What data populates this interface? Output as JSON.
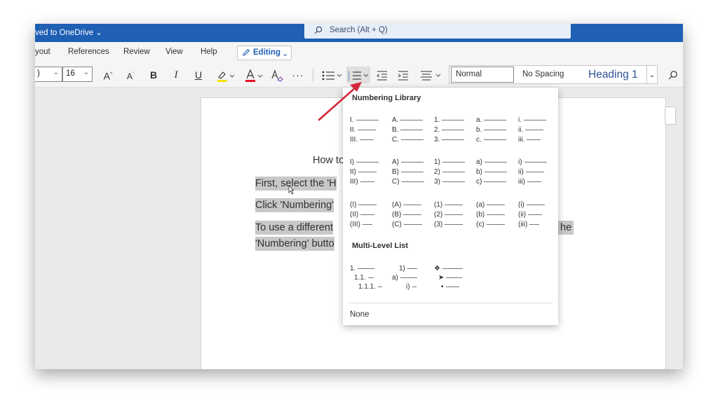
{
  "titlebar": {
    "saved_label": "ved to OneDrive ⌄",
    "search_placeholder": "Search (Alt + Q)"
  },
  "menu": {
    "items": [
      "yout",
      "References",
      "Review",
      "View",
      "Help"
    ],
    "editing": {
      "label": "Editing",
      "chevron": "⌄"
    }
  },
  "ribbon": {
    "font_name": ")",
    "font_size": "16",
    "buttons": {
      "grow": "A",
      "shrink": "A",
      "bold": "B",
      "italic": "I",
      "underline": "U",
      "more": "···"
    },
    "styles": [
      "Normal",
      "No Spacing",
      "Heading 1"
    ]
  },
  "document": {
    "title": "How to",
    "lines": [
      "First, select the 'H",
      "Click 'Numbering'",
      "To use a different",
      "he",
      "'Numbering' butto"
    ]
  },
  "numbering": {
    "library_title": "Numbering Library",
    "library": [
      [
        "I.",
        "II.",
        "III."
      ],
      [
        "A.",
        "B.",
        "C."
      ],
      [
        "1.",
        "2.",
        "3."
      ],
      [
        "a.",
        "b.",
        "c."
      ],
      [
        "i.",
        "ii.",
        "iii."
      ],
      [
        "I)",
        "II)",
        "III)"
      ],
      [
        "A)",
        "B)",
        "C)"
      ],
      [
        "1)",
        "2)",
        "3)"
      ],
      [
        "a)",
        "b)",
        "c)"
      ],
      [
        "i)",
        "ii)",
        "iii)"
      ],
      [
        "(I)",
        "(II)",
        "(III)"
      ],
      [
        "(A)",
        "(B)",
        "(C)"
      ],
      [
        "(1)",
        "(2)",
        "(3)"
      ],
      [
        "(a)",
        "(b)",
        "(c)"
      ],
      [
        "(i)",
        "(ii)",
        "(iii)"
      ]
    ],
    "multilevel_title": "Multi-Level List",
    "multilevel": [
      [
        "1.",
        "1.1.",
        "1.1.1."
      ],
      [
        "1)",
        "a)",
        "i)"
      ],
      [
        "❖",
        "➤",
        "▪"
      ]
    ],
    "none_label": "None"
  },
  "colors": {
    "titlebar": "#1f5fb4",
    "highlight": "#c8c8c8",
    "arrow": "#d3283a",
    "highlight_marker": "#f7e400",
    "font_color": "#e81123"
  }
}
